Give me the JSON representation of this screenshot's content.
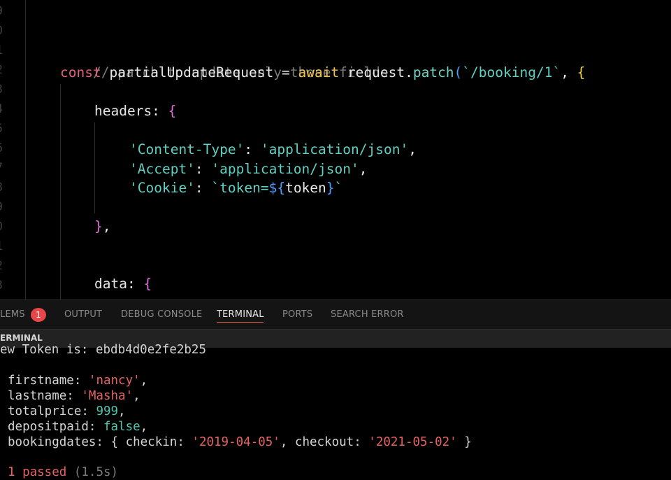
{
  "editor": {
    "line_numbers": [
      "9",
      "0",
      "1",
      "2",
      "3",
      "4",
      "5",
      "6",
      "7",
      "8",
      "9",
      "0",
      "1",
      "2",
      "3"
    ],
    "comment": "// patch to update only those fields",
    "const_kw": "const",
    "var_name": " partialUpdateRequest = ",
    "await_kw": "await",
    "request_text": " request.",
    "patch_fn": "patch",
    "paren_open": "(",
    "url_str": "`/booking/1`",
    "comma_space": ", ",
    "brace_open": "{",
    "headers_key": "headers: ",
    "headers_brace": "{",
    "content_type_key": "'Content-Type'",
    "content_type_val": "'application/json'",
    "accept_key": "'Accept'",
    "accept_val": "'application/json'",
    "cookie_key": "'Cookie'",
    "cookie_tpl_start": "`token=",
    "cookie_tpl_dollar": "${",
    "cookie_tpl_var": "token",
    "cookie_tpl_close": "}",
    "cookie_tpl_end": "`",
    "colon_space": ": ",
    "comma": ",",
    "headers_close": "}",
    "headers_close_comma": ",",
    "data_key": "data: ",
    "data_brace": "{"
  },
  "panel": {
    "tabs": [
      {
        "label": "LEMS"
      },
      {
        "label": "OUTPUT"
      },
      {
        "label": "DEBUG CONSOLE"
      },
      {
        "label": "TERMINAL"
      },
      {
        "label": "PORTS"
      },
      {
        "label": "SEARCH ERROR"
      }
    ],
    "problems_count": "1",
    "terminal_title": "ERMINAL"
  },
  "terminal": {
    "line0": "ew Token is: ebdb4d0e2fe2b25",
    "firstname_key": "firstname: ",
    "firstname_val": "'nancy'",
    "lastname_key": "lastname: ",
    "lastname_val": "'Masha'",
    "totalprice_key": "totalprice: ",
    "totalprice_val": "999",
    "depositpaid_key": "depositpaid: ",
    "depositpaid_val": "false",
    "bookingdates_key": "bookingdates: { checkin: ",
    "checkin_val": "'2019-04-05'",
    "checkout_key": ", checkout: ",
    "checkout_val": "'2021-05-02'",
    "bookingdates_end": " }",
    "comma": ",",
    "passed": "1 passed",
    "duration": " (1.5s)"
  },
  "colors": {
    "keyword": "#e25f7a",
    "function": "#6fd3c4",
    "await": "#f0c24a",
    "string": "#5fd0c2",
    "terminal_string": "#e56262",
    "badge": "#e8474a",
    "active_tab_underline": "#e8674a"
  }
}
